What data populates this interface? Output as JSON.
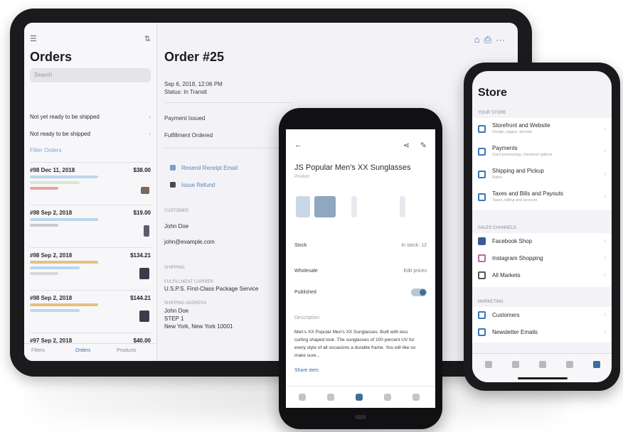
{
  "tablet": {
    "sidebar": {
      "title": "Orders",
      "search_placeholder": "Search",
      "filters": [
        "Not yet ready to be shipped",
        "Not ready to be shipped"
      ],
      "filter_link": "Filter Orders",
      "orders": [
        {
          "title": "#98 Dec 11, 2018",
          "amount": "$38.00",
          "status_color": "#e7a49f"
        },
        {
          "title": "#98 Sep 2, 2018",
          "amount": "$19.00",
          "status_color": "#c9c9ce"
        },
        {
          "title": "#98 Sep 2, 2018",
          "amount": "$134.21",
          "status_color": "#e7c07f"
        },
        {
          "title": "#98 Sep 2, 2018",
          "amount": "$144.21",
          "status_color": "#e7c07f"
        },
        {
          "title": "#97 Sep 2, 2018",
          "amount": "$40.00",
          "status_color": "#c9c9ce"
        }
      ],
      "bottom_tabs": [
        "Filters",
        "Orders",
        "Products"
      ]
    },
    "main": {
      "title": "Order #25",
      "date_line1": "Sep 6, 2018, 12:06 PM",
      "date_line2": "Status: In Transit",
      "status_1": "Payment Issued",
      "status_2": "Fulfillment Ordered",
      "action_1": "Resend Receipt Email",
      "action_2": "Issue Refund",
      "customer_label": "Customer",
      "customer_name": "John Doe",
      "customer_email": "john@example.com",
      "shipping_label": "Shipping",
      "carrier_label": "Fulfillment Carrier",
      "carrier": "U.S.P.S. First-Class Package Service",
      "address_label": "Shipping Address",
      "address_name": "John Doe",
      "address_line": "STEP 1",
      "address_city": "New York, New York 10001"
    }
  },
  "android": {
    "product_title": "JS Popular Men's XX Sunglasses",
    "product_sub": "Product",
    "rows": [
      {
        "label": "Stock",
        "value": "In stock: 12"
      },
      {
        "label": "Wholesale",
        "value": "Edit prices"
      },
      {
        "label": "Published",
        "value": ""
      }
    ],
    "description_label": "Description",
    "description": "Men's XX Popular Men's XX Sunglasses. Built with less curling shaped look. The sunglasses of 100 percent UV for every style of all occasions a durable frame. You will like so make sure...",
    "link": "Share item"
  },
  "iphone": {
    "title": "Store",
    "sections": [
      {
        "header": "Your store",
        "items": [
          {
            "label": "Storefront and Website",
            "sub": "Design, pages, domain"
          },
          {
            "label": "Payments",
            "sub": "Card processing, checkout options"
          },
          {
            "label": "Shipping and Pickup",
            "sub": "Rates"
          },
          {
            "label": "Taxes and Bills and Payouts",
            "sub": "Taxes, billing and account"
          }
        ]
      },
      {
        "header": "Sales Channels",
        "items": [
          {
            "label": "Facebook Shop",
            "sub": "",
            "icon": "facebook"
          },
          {
            "label": "Instagram Shopping",
            "sub": "",
            "icon": "instagram"
          },
          {
            "label": "All Markets",
            "sub": "",
            "icon": "globe"
          }
        ]
      },
      {
        "header": "Marketing",
        "items": [
          {
            "label": "Customers",
            "sub": ""
          },
          {
            "label": "Newsletter Emails",
            "sub": ""
          }
        ]
      }
    ]
  }
}
